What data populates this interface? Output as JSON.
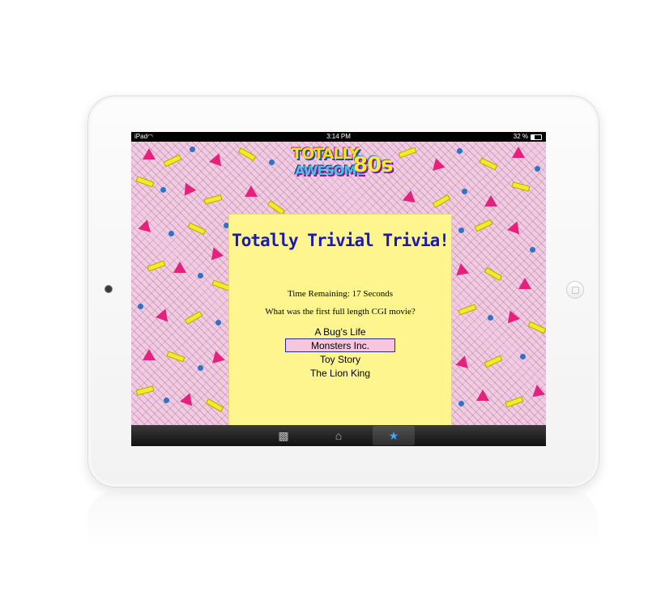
{
  "statusbar": {
    "device": "iPad",
    "time": "3:14 PM",
    "battery": "32 %"
  },
  "logo": {
    "line1": "TOTALLY",
    "line2": "AWESOME",
    "line3": "80s"
  },
  "trivia": {
    "title": "Totally Trivial Trivia!",
    "timer": "Time Remaining: 17 Seconds",
    "question": "What was the first full length CGI movie?",
    "answers": [
      {
        "label": "A Bug's Life",
        "selected": false
      },
      {
        "label": "Monsters Inc.",
        "selected": true
      },
      {
        "label": "Toy Story",
        "selected": false
      },
      {
        "label": "The Lion King",
        "selected": false
      }
    ]
  },
  "tabbar": {
    "tabs": [
      {
        "icon": "camera-icon",
        "active": false
      },
      {
        "icon": "home-icon",
        "active": false
      },
      {
        "icon": "star-icon",
        "active": true
      }
    ]
  },
  "colors": {
    "background_pink": "#f4c9e3",
    "card_yellow": "#fff58f",
    "title_blue": "#1a1ab8",
    "selected_pink": "#f7c5de",
    "triangle_magenta": "#e8207d",
    "bar_yellow": "#f2ea2a",
    "dot_blue": "#2d74c9"
  }
}
